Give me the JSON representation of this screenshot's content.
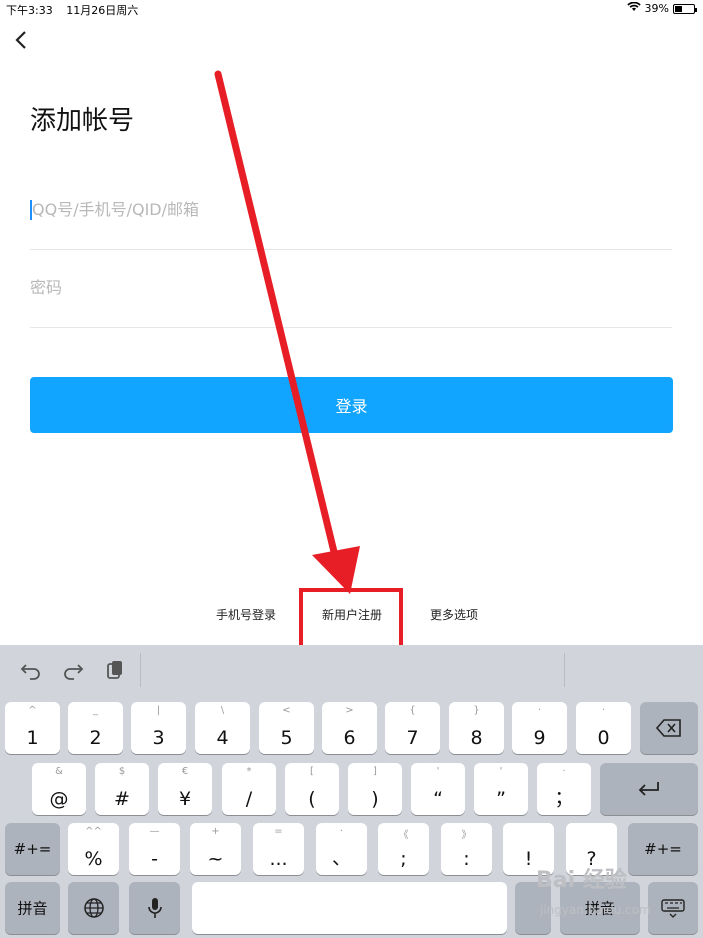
{
  "status": {
    "time": "下午3:33",
    "date": "11月26日周六",
    "battery": "39%"
  },
  "page": {
    "title": "添加帐号",
    "login_label": "登录"
  },
  "form": {
    "account_placeholder": "QQ号/手机号/QID/邮箱",
    "password_placeholder": "密码"
  },
  "links": {
    "phone_login": "手机号登录",
    "register": "新用户注册",
    "more": "更多选项"
  },
  "annotation": {
    "color": "#e81e26"
  },
  "keyboard": {
    "row1": [
      {
        "main": "1",
        "sub": "^"
      },
      {
        "main": "2",
        "sub": "_"
      },
      {
        "main": "3",
        "sub": "|"
      },
      {
        "main": "4",
        "sub": "\\"
      },
      {
        "main": "5",
        "sub": "<"
      },
      {
        "main": "6",
        "sub": ">"
      },
      {
        "main": "7",
        "sub": "{"
      },
      {
        "main": "8",
        "sub": "}"
      },
      {
        "main": "9",
        "sub": "·"
      },
      {
        "main": "0",
        "sub": "·"
      }
    ],
    "row2": [
      {
        "main": "@",
        "sub": "&"
      },
      {
        "main": "#",
        "sub": "$"
      },
      {
        "main": "¥",
        "sub": "€"
      },
      {
        "main": "/",
        "sub": "*"
      },
      {
        "main": "(",
        "sub": "["
      },
      {
        "main": ")",
        "sub": "]"
      },
      {
        "main": "“",
        "sub": "'"
      },
      {
        "main": "”",
        "sub": "'"
      },
      {
        "main": "；",
        "sub": "·"
      }
    ],
    "row3": [
      {
        "main": "%",
        "sub": "^^"
      },
      {
        "main": "-",
        "sub": "—"
      },
      {
        "main": "~",
        "sub": "+"
      },
      {
        "main": "...",
        "sub": "="
      },
      {
        "main": "、",
        "sub": "·"
      },
      {
        "main": ";",
        "sub": "《"
      },
      {
        "main": ":",
        "sub": "》"
      },
      {
        "main": "!",
        "sub": ""
      },
      {
        "main": "?",
        "sub": ""
      }
    ],
    "symbols_label": "#+=",
    "pinyin_label": "拼音",
    "watermark_text": "Bai 经验",
    "watermark_url": "jingyan.baidu.com"
  }
}
